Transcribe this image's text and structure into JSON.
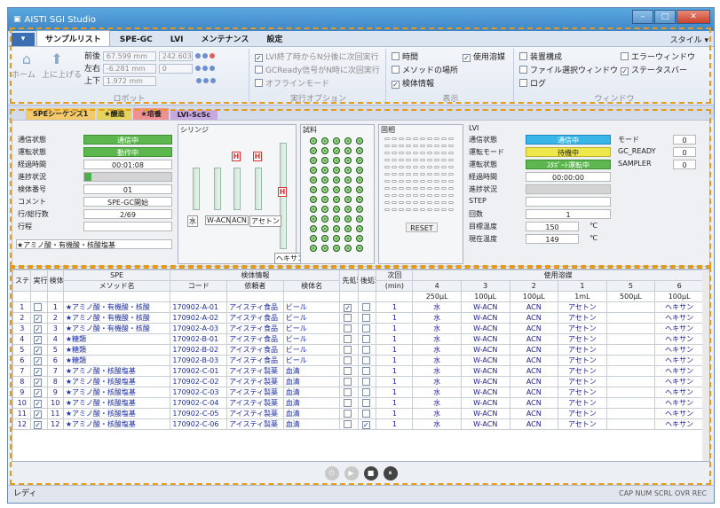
{
  "window": {
    "title": "AISTI SGI Studio",
    "min": "–",
    "max": "□",
    "close": "✕"
  },
  "ribbon": {
    "app_button": "▾",
    "tabs": [
      "サンプルリスト",
      "SPE-GC",
      "LVI",
      "メンテナンス",
      "設定"
    ],
    "style_label": "スタイル ▾",
    "robot": {
      "home": "ホーム",
      "lift": "上に上げる",
      "rows": [
        {
          "label": "前後",
          "value": "67.599 mm",
          "extra": "242.603"
        },
        {
          "label": "左右",
          "value": "-6.281 mm",
          "extra": "0"
        },
        {
          "label": "上下",
          "value": "1.972 mm",
          "extra": ""
        }
      ],
      "group": "ロボット"
    },
    "exec": {
      "items": [
        "LVI終了時からN分後に次回実行",
        "GCReady信号がN時に次回実行",
        "オフラインモード"
      ],
      "group": "実行オプション"
    },
    "display": {
      "col1": [
        "時間",
        "メソッドの場所",
        "検体情報"
      ],
      "col1_checked": [
        false,
        false,
        true
      ],
      "col2": [
        "使用溶媒"
      ],
      "col2_checked": [
        true
      ],
      "group": "表示"
    },
    "window_grp": {
      "col1": [
        "装置構成",
        "ファイル選択ウィンドウ",
        "ログ"
      ],
      "col1_checked": [
        false,
        false,
        false
      ],
      "col2": [
        "エラーウィンドウ",
        "ステータスバー"
      ],
      "col2_checked": [
        false,
        true
      ],
      "group": "ウィンドウ"
    }
  },
  "doc_tabs": [
    "SPEシーケンス1",
    "★醸造",
    "★培養",
    "LVI-ScSc"
  ],
  "status": {
    "labels": [
      "通信状態",
      "運転状態",
      "経過時間",
      "進捗状況",
      "検体番号",
      "コメント",
      "行/総行数",
      "行程"
    ],
    "values": [
      "通信中",
      "動作中",
      "00:01:08",
      "",
      "01",
      "SPE-GC開始",
      "2/69",
      ""
    ],
    "footer": "★アミノ酸・有機酸・核酸塩基"
  },
  "syringe": {
    "title": "シリンジ",
    "labels": [
      "水",
      "W-ACN",
      "ACN",
      "アセトン",
      "ヘキサン"
    ],
    "h": "H"
  },
  "sample": {
    "title": "試料"
  },
  "solid": {
    "title": "固相",
    "reset": "RESET"
  },
  "lvi": {
    "title": "LVI",
    "labels": [
      "通信状態",
      "運転モード",
      "運転状態",
      "経過時間",
      "進捗状況",
      "STEP",
      "回数",
      "目標温度",
      "現在温度"
    ],
    "values": [
      "通信中",
      "待機中",
      "ｽﾀﾎﾟｰﾄ運転中",
      "00:00:00",
      "",
      "",
      "1",
      "150",
      "149"
    ],
    "unit": "℃",
    "mode_labels": [
      "モード",
      "GC_READY",
      "SAMPLER"
    ],
    "mode_values": [
      "0",
      "0",
      "0"
    ]
  },
  "table": {
    "h_step": "ステップ",
    "h_exec": "実行",
    "h_sno": "検体No",
    "h_spe": "SPE",
    "h_method": "メソッド名",
    "h_sample": "検体情報",
    "h_code": "コード",
    "h_client": "依頼者",
    "h_sname": "検体名",
    "h_pre": "先処理",
    "h_post": "後処理",
    "h_next": "次回",
    "h_min": "(min)",
    "h_solvent": "使用溶媒",
    "solvent_nums": [
      "4",
      "3",
      "2",
      "1",
      "5",
      "6"
    ],
    "solvent_vols": [
      "250µL",
      "100µL",
      "100µL",
      "1mL",
      "500µL",
      "100µL"
    ],
    "rows": [
      {
        "n": "1",
        "ex": false,
        "no": "1",
        "method": "★アミノ酸・有機酸・核酸",
        "code": "170902-A-01",
        "client": "アイスティ食品",
        "sname": "ビール",
        "pre": true,
        "post": false,
        "next": "1",
        "s": [
          "水",
          "W-ACN",
          "ACN",
          "アセトン",
          "",
          "ヘキサン"
        ]
      },
      {
        "n": "2",
        "ex": true,
        "no": "2",
        "method": "★アミノ酸・有機酸・核酸",
        "code": "170902-A-02",
        "client": "アイスティ食品",
        "sname": "ビール",
        "pre": false,
        "post": false,
        "next": "1",
        "s": [
          "水",
          "W-ACN",
          "ACN",
          "アセトン",
          "",
          "ヘキサン"
        ]
      },
      {
        "n": "3",
        "ex": true,
        "no": "3",
        "method": "★アミノ酸・有機酸・核酸",
        "code": "170902-A-03",
        "client": "アイスティ食品",
        "sname": "ビール",
        "pre": false,
        "post": false,
        "next": "1",
        "s": [
          "水",
          "W-ACN",
          "ACN",
          "アセトン",
          "",
          "ヘキサン"
        ]
      },
      {
        "n": "4",
        "ex": true,
        "no": "4",
        "method": "★糖類",
        "code": "170902-B-01",
        "client": "アイスティ食品",
        "sname": "ビール",
        "pre": false,
        "post": false,
        "next": "1",
        "s": [
          "水",
          "W-ACN",
          "ACN",
          "アセトン",
          "",
          "ヘキサン"
        ]
      },
      {
        "n": "5",
        "ex": true,
        "no": "5",
        "method": "★糖類",
        "code": "170902-B-02",
        "client": "アイスティ食品",
        "sname": "ビール",
        "pre": false,
        "post": false,
        "next": "1",
        "s": [
          "水",
          "W-ACN",
          "ACN",
          "アセトン",
          "",
          "ヘキサン"
        ]
      },
      {
        "n": "6",
        "ex": true,
        "no": "6",
        "method": "★糖類",
        "code": "170902-B-03",
        "client": "アイスティ食品",
        "sname": "ビール",
        "pre": false,
        "post": false,
        "next": "1",
        "s": [
          "水",
          "W-ACN",
          "ACN",
          "アセトン",
          "",
          "ヘキサン"
        ]
      },
      {
        "n": "7",
        "ex": true,
        "no": "7",
        "method": "★アミノ酸・核酸塩基",
        "code": "170902-C-01",
        "client": "アイスティ製薬",
        "sname": "血清",
        "pre": false,
        "post": false,
        "next": "1",
        "s": [
          "水",
          "W-ACN",
          "ACN",
          "アセトン",
          "",
          "ヘキサン"
        ]
      },
      {
        "n": "8",
        "ex": true,
        "no": "8",
        "method": "★アミノ酸・核酸塩基",
        "code": "170902-C-02",
        "client": "アイスティ製薬",
        "sname": "血清",
        "pre": false,
        "post": false,
        "next": "1",
        "s": [
          "水",
          "W-ACN",
          "ACN",
          "アセトン",
          "",
          "ヘキサン"
        ]
      },
      {
        "n": "9",
        "ex": true,
        "no": "9",
        "method": "★アミノ酸・核酸塩基",
        "code": "170902-C-03",
        "client": "アイスティ製薬",
        "sname": "血清",
        "pre": false,
        "post": false,
        "next": "1",
        "s": [
          "水",
          "W-ACN",
          "ACN",
          "アセトン",
          "",
          "ヘキサン"
        ]
      },
      {
        "n": "10",
        "ex": true,
        "no": "10",
        "method": "★アミノ酸・核酸塩基",
        "code": "170902-C-04",
        "client": "アイスティ製薬",
        "sname": "血清",
        "pre": false,
        "post": false,
        "next": "1",
        "s": [
          "水",
          "W-ACN",
          "ACN",
          "アセトン",
          "",
          "ヘキサン"
        ]
      },
      {
        "n": "11",
        "ex": true,
        "no": "11",
        "method": "★アミノ酸・核酸塩基",
        "code": "170902-C-05",
        "client": "アイスティ製薬",
        "sname": "血清",
        "pre": false,
        "post": false,
        "next": "1",
        "s": [
          "水",
          "W-ACN",
          "ACN",
          "アセトン",
          "",
          "ヘキサン"
        ]
      },
      {
        "n": "12",
        "ex": true,
        "no": "12",
        "method": "★アミノ酸・核酸塩基",
        "code": "170902-C-06",
        "client": "アイスティ製薬",
        "sname": "血清",
        "pre": false,
        "post": true,
        "next": "1",
        "s": [
          "水",
          "W-ACN",
          "ACN",
          "アセトン",
          "",
          "ヘキサン"
        ]
      }
    ]
  },
  "controls": [
    "⏻",
    "▶",
    "■",
    "⏸"
  ],
  "statusbar": {
    "left": "レディ",
    "right": "CAP NUM SCRL OVR REC"
  }
}
